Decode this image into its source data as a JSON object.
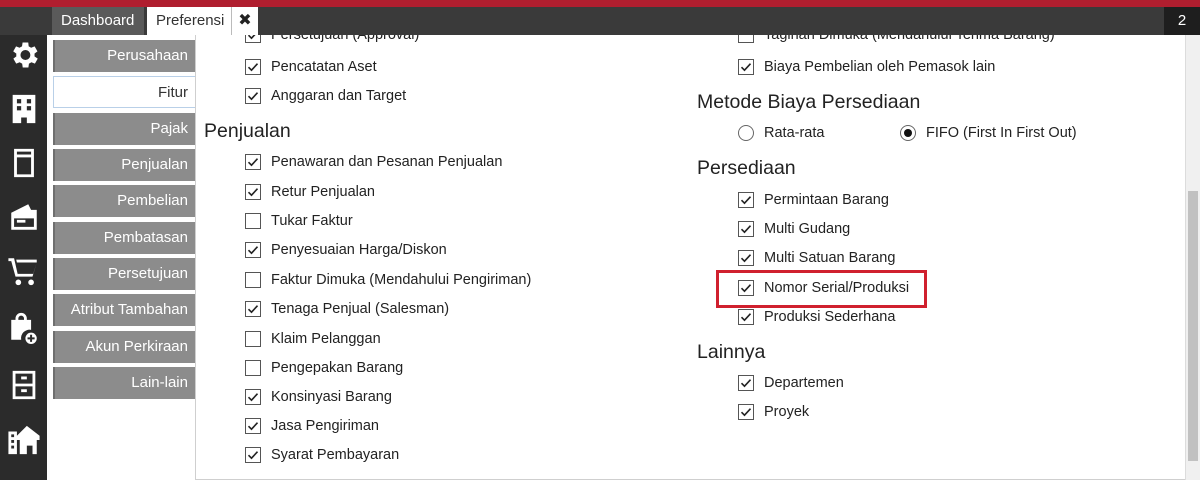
{
  "window": {
    "tabs": [
      {
        "label": "Dashboard"
      },
      {
        "label": "Preferensi"
      }
    ],
    "close_glyph": "✖",
    "tab_count": "2"
  },
  "icon_rail": [
    "gear-icon",
    "building-icon",
    "book-icon",
    "card-icon",
    "cart-icon",
    "bag-add-icon",
    "archive-icon",
    "property-icon"
  ],
  "sidebar": {
    "items": [
      {
        "label": "Perusahaan"
      },
      {
        "label": "Fitur"
      },
      {
        "label": "Pajak"
      },
      {
        "label": "Penjualan"
      },
      {
        "label": "Pembelian"
      },
      {
        "label": "Pembatasan"
      },
      {
        "label": "Persetujuan"
      },
      {
        "label": "Atribut Tambahan"
      },
      {
        "label": "Akun Perkiraan"
      },
      {
        "label": "Lain-lain"
      }
    ],
    "active_index": 1
  },
  "left_column": {
    "top_items": [
      {
        "label": "Persetujuan (Approval)",
        "checked": true
      },
      {
        "label": "Pencatatan Aset",
        "checked": true
      },
      {
        "label": "Anggaran dan Target",
        "checked": true
      }
    ],
    "penjualan": {
      "title": "Penjualan",
      "items": [
        {
          "label": "Penawaran dan Pesanan Penjualan",
          "checked": true
        },
        {
          "label": "Retur Penjualan",
          "checked": true
        },
        {
          "label": "Tukar Faktur",
          "checked": false
        },
        {
          "label": "Penyesuaian Harga/Diskon",
          "checked": true
        },
        {
          "label": "Faktur Dimuka (Mendahului Pengiriman)",
          "checked": false
        },
        {
          "label": "Tenaga Penjual (Salesman)",
          "checked": true
        },
        {
          "label": "Klaim Pelanggan",
          "checked": false
        },
        {
          "label": "Pengepakan Barang",
          "checked": false
        },
        {
          "label": "Konsinyasi Barang",
          "checked": true
        },
        {
          "label": "Jasa Pengiriman",
          "checked": true
        },
        {
          "label": "Syarat Pembayaran",
          "checked": true
        }
      ]
    }
  },
  "right_column": {
    "top_items": [
      {
        "label": "Tagihan Dimuka (Mendahului Terima Barang)",
        "checked": false
      },
      {
        "label": "Biaya Pembelian oleh Pemasok lain",
        "checked": true
      }
    ],
    "metode": {
      "title": "Metode Biaya Persediaan",
      "options": [
        {
          "label": "Rata-rata",
          "selected": false
        },
        {
          "label": "FIFO (First In First Out)",
          "selected": true
        }
      ]
    },
    "persediaan": {
      "title": "Persediaan",
      "items": [
        {
          "label": "Permintaan Barang",
          "checked": true
        },
        {
          "label": "Multi Gudang",
          "checked": true
        },
        {
          "label": "Multi Satuan Barang",
          "checked": true
        },
        {
          "label": "Nomor Serial/Produksi",
          "checked": true
        },
        {
          "label": "Produksi Sederhana",
          "checked": true
        }
      ]
    },
    "lainnya": {
      "title": "Lainnya",
      "items": [
        {
          "label": "Departemen",
          "checked": true
        },
        {
          "label": "Proyek",
          "checked": true
        }
      ]
    }
  },
  "colors": {
    "brand_bar": "#b01e2f",
    "highlight_border": "#d0202e",
    "sidebar_item": "#8c8c8c",
    "icon_rail": "#2b2b2b"
  }
}
